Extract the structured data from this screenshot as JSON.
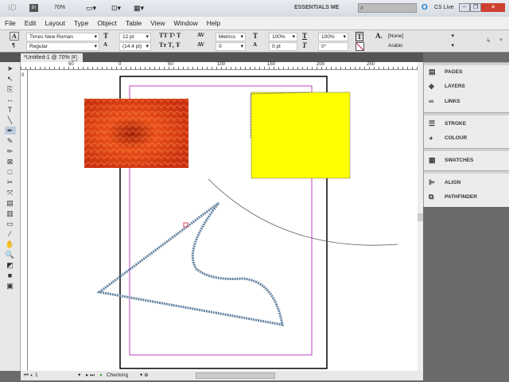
{
  "appbar": {
    "logo": "ID",
    "bridge": "Br",
    "zoom": "70%",
    "workspace": "ESSENTIALS ME",
    "search_placeholder": "",
    "cslive": "CS Live"
  },
  "menu": [
    "File",
    "Edit",
    "Layout",
    "Type",
    "Object",
    "Table",
    "View",
    "Window",
    "Help"
  ],
  "control": {
    "font": "Times New Roman",
    "style": "Regular",
    "size": "12 pt",
    "leading": "(14.4 pt)",
    "kerning": "Metrics",
    "tracking": "0",
    "vscale": "100%",
    "hscale": "100%",
    "baseline": "0 pt",
    "skew": "0°",
    "char_style": "[None]",
    "language": "Arabic"
  },
  "document": {
    "tab": "*Untitled-1 @ 70%"
  },
  "ruler": {
    "h": [
      "50",
      "0",
      "50",
      "100",
      "150",
      "200",
      "250"
    ],
    "v": [
      "0"
    ]
  },
  "panels": [
    {
      "label": "PAGES",
      "icon": "pages-icon"
    },
    {
      "label": "LAYERS",
      "icon": "layers-icon"
    },
    {
      "label": "LINKS",
      "icon": "links-icon"
    },
    {
      "label": "STROKE",
      "icon": "stroke-icon"
    },
    {
      "label": "COLOUR",
      "icon": "colour-icon"
    },
    {
      "label": "SWATCHES",
      "icon": "swatches-icon"
    },
    {
      "label": "ALIGN",
      "icon": "align-icon"
    },
    {
      "label": "PATHFINDER",
      "icon": "pathfinder-icon"
    }
  ],
  "status": {
    "page": "1",
    "preflight": "Checking"
  },
  "colors": {
    "yellow": "#ffff00",
    "margin": "#c040c0",
    "flower": "#e8501a"
  }
}
